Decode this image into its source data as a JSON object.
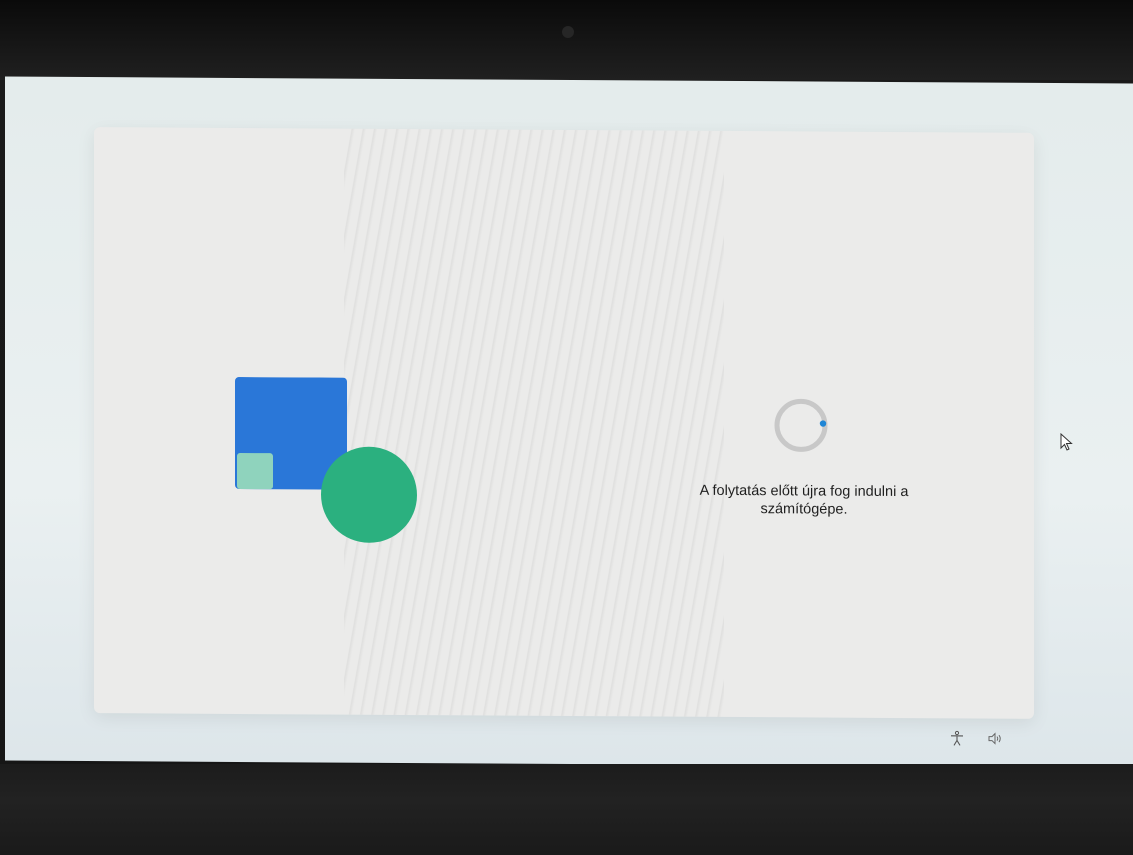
{
  "status": {
    "message": "A folytatás előtt újra fog indulni a\nszámítógépe."
  },
  "icons": {
    "logo": "windows-setup-logo",
    "spinner": "loading-spinner",
    "accessibility": "accessibility-icon",
    "volume": "volume-icon",
    "cursor": "mouse-pointer"
  },
  "colors": {
    "logo_blue": "#2a77d8",
    "logo_light": "#8fd3bd",
    "logo_green": "#2bb07f",
    "spinner_track": "#c8c8c8",
    "spinner_accent": "#1f86d6"
  }
}
